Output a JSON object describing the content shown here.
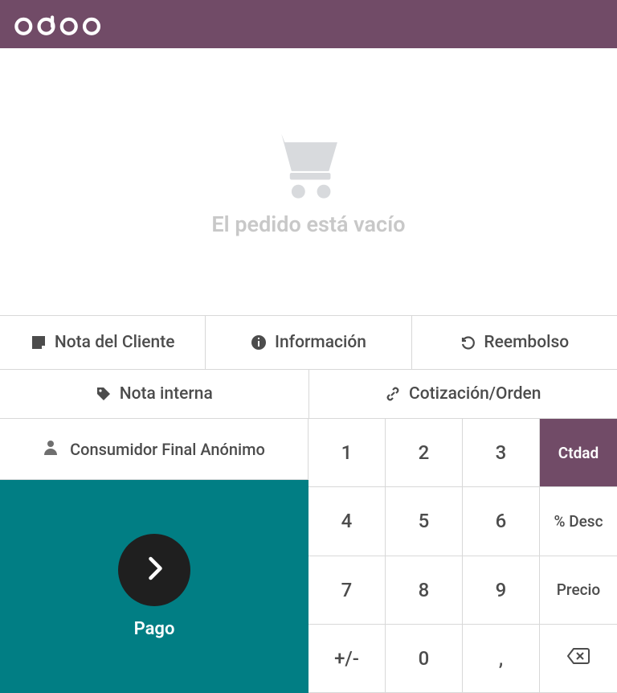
{
  "brand": "odoo",
  "order": {
    "empty_message": "El pedido está vacío"
  },
  "controls": {
    "customer_note": "Nota del Cliente",
    "info": "Información",
    "refund": "Reembolso",
    "internal_note": "Nota interna",
    "quotation_order": "Cotización/Orden"
  },
  "customer": {
    "name": "Consumidor Final Anónimo"
  },
  "payment": {
    "label": "Pago"
  },
  "numpad": {
    "keys": [
      "1",
      "2",
      "3",
      "4",
      "5",
      "6",
      "7",
      "8",
      "9",
      "+/-",
      "0",
      ","
    ],
    "mode_qty": "Ctdad",
    "mode_disc": "% Desc",
    "mode_price": "Precio"
  }
}
